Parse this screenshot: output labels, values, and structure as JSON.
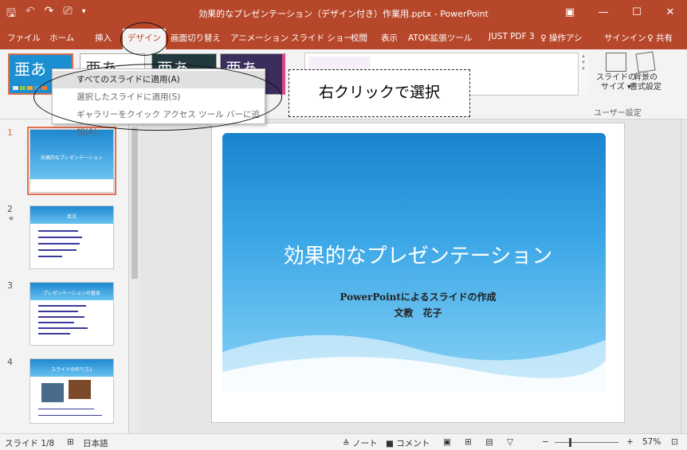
{
  "titlebar": {
    "title": "効果的なプレゼンテーション（デザイン付き）作業用.pptx - PowerPoint",
    "qat": {
      "save": "🖫",
      "undo": "↶",
      "redo": "↷",
      "present": "⎚",
      "customize": "▾"
    },
    "buttons": {
      "ribbon_options": "▣",
      "minimize": "—",
      "restore": "☐",
      "close": "✕"
    }
  },
  "tabs": [
    "ファイル",
    "ホーム",
    "挿入",
    "デザイン",
    "画面切り替え",
    "アニメーション",
    "スライド ショー",
    "校閲",
    "表示",
    "ATOK拡張ツール",
    "JUST PDF 3",
    "♀ 操作アシ",
    "サインイン",
    "♀ 共有"
  ],
  "active_tab": "デザイン",
  "themes": [
    {
      "glyph": "亜あ",
      "bg": "#1b8fd2",
      "fg": "#ffffff"
    },
    {
      "glyph": "亜あ",
      "bg": "#ffffff",
      "fg": "#333333"
    },
    {
      "glyph": "亜あ",
      "bg": "#223a3f",
      "fg": "#ffffff"
    },
    {
      "glyph": "亜あ",
      "bg": "#3b2d5c",
      "fg": "#ffffff"
    }
  ],
  "ribbon": {
    "slide_size_label": "スライドの\nサイズ ▾",
    "format_bg_label": "背景の\n書式設定",
    "group_label": "ユーザー設定"
  },
  "context_menu": {
    "items": [
      "すべてのスライドに適用(A)",
      "選択したスライドに適用(S)",
      "ギャラリーをクイック アクセス ツール バーに追加(A)"
    ]
  },
  "callout": "右クリックで選択",
  "thumbnails": [
    {
      "num": "1",
      "title": "効果的なプレゼンテーション"
    },
    {
      "num": "2",
      "title": "目次"
    },
    {
      "num": "3",
      "title": "プレゼンテーションの基本"
    },
    {
      "num": "4",
      "title": "スライドの作り方1"
    }
  ],
  "slide": {
    "title": "効果的なプレゼンテーション",
    "subtitle1": "PowerPointによるスライドの作成",
    "subtitle2": "文教　花子"
  },
  "statusbar": {
    "slide_info": "スライド 1/8",
    "language": "日本語",
    "notes": "≙ ノート",
    "comments": "■ コメント",
    "zoom": "57%"
  },
  "colors": {
    "accent": "#b7472a",
    "selection": "#e07050"
  }
}
